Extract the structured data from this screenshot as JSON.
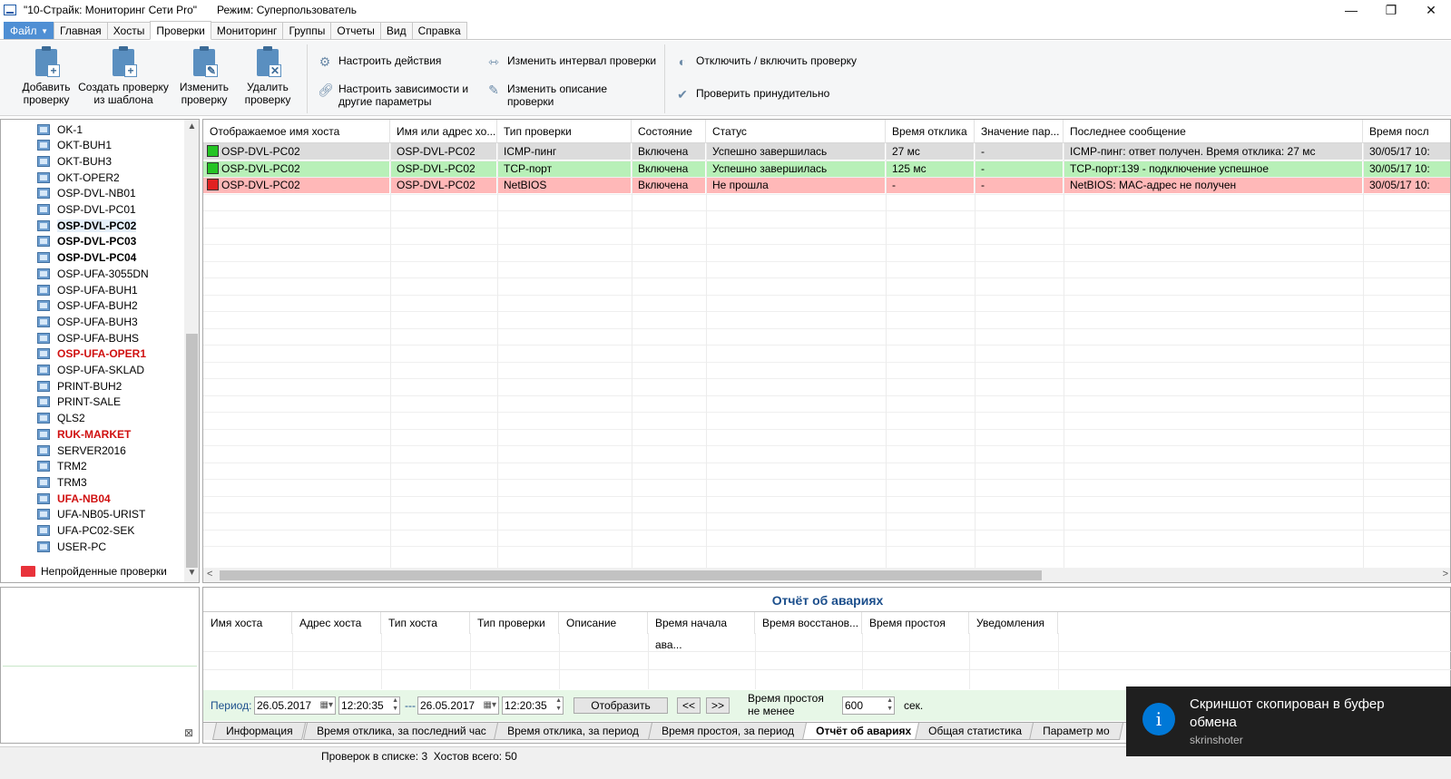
{
  "titlebar": {
    "title": "\"10-Страйк: Мониторинг Сети Pro\"",
    "mode": "Режим: Суперпользователь",
    "minimize": "—",
    "maximize": "❐",
    "close": "✕"
  },
  "menu": {
    "file": "Файл",
    "tabs": [
      "Главная",
      "Хосты",
      "Проверки",
      "Мониторинг",
      "Группы",
      "Отчеты",
      "Вид",
      "Справка"
    ],
    "active": "Проверки"
  },
  "ribbon": {
    "big": [
      {
        "label": "Добавить\nпроверку",
        "icon": "add-check-icon"
      },
      {
        "label": "Создать проверку\nиз шаблона",
        "icon": "template-check-icon"
      },
      {
        "label": "Изменить\nпроверку",
        "icon": "edit-check-icon"
      },
      {
        "label": "Удалить\nпроверку",
        "icon": "delete-check-icon"
      }
    ],
    "small": {
      "configure_actions": "Настроить действия",
      "configure_deps": "Настроить зависимости и\nдругие параметры",
      "change_interval": "Изменить интервал проверки",
      "change_desc": "Изменить описание\nпроверки",
      "toggle_check": "Отключить / включить проверку",
      "force_check": "Проверить принудительно"
    }
  },
  "tree": {
    "items": [
      {
        "name": "OK-1",
        "style": "normal"
      },
      {
        "name": "OKT-BUH1",
        "style": "normal"
      },
      {
        "name": "OKT-BUH3",
        "style": "normal"
      },
      {
        "name": "OKT-OPER2",
        "style": "normal"
      },
      {
        "name": "OSP-DVL-NB01",
        "style": "normal"
      },
      {
        "name": "OSP-DVL-PC01",
        "style": "normal"
      },
      {
        "name": "OSP-DVL-PC02",
        "style": "selected-bold"
      },
      {
        "name": "OSP-DVL-PC03",
        "style": "bold"
      },
      {
        "name": "OSP-DVL-PC04",
        "style": "bold"
      },
      {
        "name": "OSP-UFA-3055DN",
        "style": "normal"
      },
      {
        "name": "OSP-UFA-BUH1",
        "style": "normal"
      },
      {
        "name": "OSP-UFA-BUH2",
        "style": "normal"
      },
      {
        "name": "OSP-UFA-BUH3",
        "style": "normal"
      },
      {
        "name": "OSP-UFA-BUHS",
        "style": "normal"
      },
      {
        "name": "OSP-UFA-OPER1",
        "style": "red"
      },
      {
        "name": "OSP-UFA-SKLAD",
        "style": "normal"
      },
      {
        "name": "PRINT-BUH2",
        "style": "normal"
      },
      {
        "name": "PRINT-SALE",
        "style": "normal"
      },
      {
        "name": "QLS2",
        "style": "normal"
      },
      {
        "name": "RUK-MARKET",
        "style": "red"
      },
      {
        "name": "SERVER2016",
        "style": "normal"
      },
      {
        "name": "TRM2",
        "style": "normal"
      },
      {
        "name": "TRM3",
        "style": "normal"
      },
      {
        "name": "UFA-NB04",
        "style": "red"
      },
      {
        "name": "UFA-NB05-URIST",
        "style": "normal"
      },
      {
        "name": "UFA-PC02-SEK",
        "style": "normal"
      },
      {
        "name": "USER-PC",
        "style": "normal"
      }
    ],
    "failed_folder": "Непройденные проверки"
  },
  "checks": {
    "columns": [
      "Отображаемое имя хоста",
      "Имя или адрес хо...",
      "Тип проверки",
      "Состояние",
      "Статус",
      "Время отклика",
      "Значение пар...",
      "Последнее сообщение",
      "Время посл"
    ],
    "rows": [
      {
        "status": "ok",
        "display_name": "OSP-DVL-PC02",
        "address": "OSP-DVL-PC02",
        "type": "ICMP-пинг",
        "state": "Включена",
        "result": "Успешно завершилась",
        "response": "27 мс",
        "param": "-",
        "message": "ICMP-пинг: ответ получен. Время отклика: 27 мс",
        "time": "30/05/17 10:"
      },
      {
        "status": "ok",
        "display_name": "OSP-DVL-PC02",
        "address": "OSP-DVL-PC02",
        "type": "TCP-порт",
        "state": "Включена",
        "result": "Успешно завершилась",
        "response": "125 мс",
        "param": "-",
        "message": "TCP-порт:139 - подключение успешное",
        "time": "30/05/17 10:"
      },
      {
        "status": "fail",
        "display_name": "OSP-DVL-PC02",
        "address": "OSP-DVL-PC02",
        "type": "NetBIOS",
        "state": "Включена",
        "result": "Не прошла",
        "response": "-",
        "param": "-",
        "message": "NetBIOS: MAC-адрес не получен",
        "time": "30/05/17 10:"
      }
    ]
  },
  "report": {
    "title": "Отчёт об авариях",
    "columns": [
      "Имя хоста",
      "Адрес хоста",
      "Тип хоста",
      "Тип проверки",
      "Описание",
      "Время начала ава...",
      "Время восстанов...",
      "Время простоя",
      "Уведомления"
    ],
    "period_label": "Период:",
    "date_from": "26.05.2017",
    "time_from": "12:20:35",
    "dash": "---",
    "date_to": "26.05.2017",
    "time_to": "12:20:35",
    "show_button": "Отобразить",
    "prev": "<<",
    "next": ">>",
    "downtime_label": "Время простоя\nне менее",
    "downtime_value": "600",
    "sec": "сек."
  },
  "bottom_tabs": {
    "items": [
      "Информация",
      "Время отклика, за последний час",
      "Время отклика, за период",
      "Время простоя, за период",
      "Отчёт об авариях",
      "Общая статистика",
      "Параметр мо"
    ],
    "active": "Отчёт об авариях"
  },
  "statusbar": {
    "text": "Проверок в списке: 3  Хостов всего: 50"
  },
  "toast": {
    "icon": "i",
    "message": "Скриншот скопирован в буфер обмена",
    "source": "skrinshoter"
  },
  "colors": {
    "row_ok": "#b8f0b8",
    "row_fail": "#ffb8b8",
    "row_selected": "#dcdcdc",
    "accent": "#4f8fd4",
    "red_host": "#d01010"
  }
}
